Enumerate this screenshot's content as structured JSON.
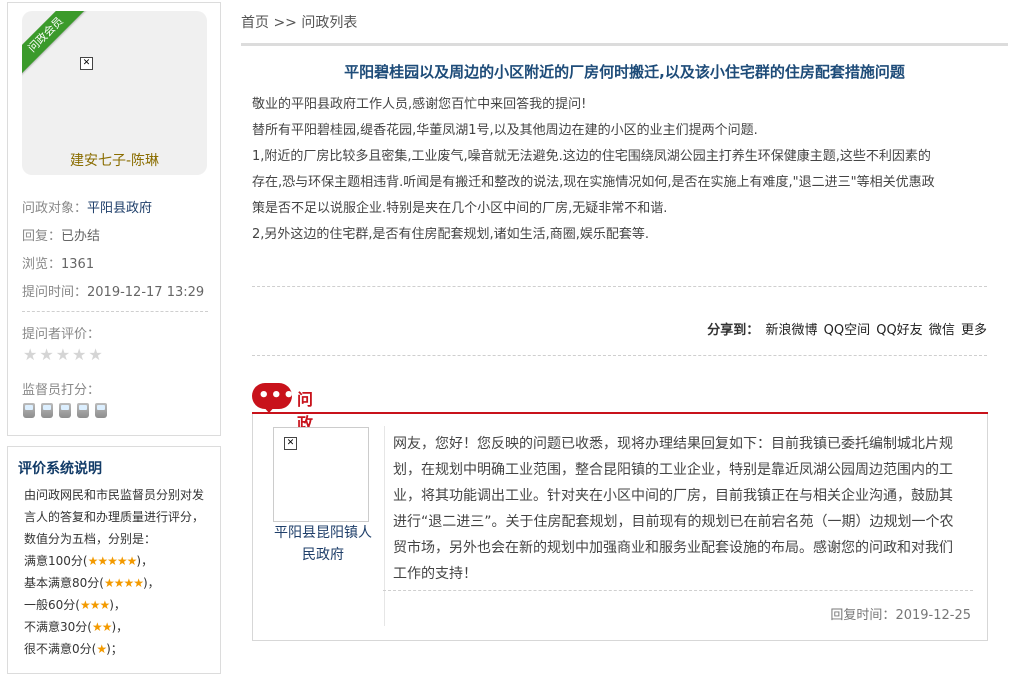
{
  "profile": {
    "badge": "问政会员",
    "name": "建安七子-陈琳",
    "target_label": "问政对象：",
    "target_value": "平阳县政府",
    "reply_label": "回复：",
    "reply_value": "已办结",
    "views_label": "浏览：",
    "views_value": "1361",
    "asktime_label": "提问时间：",
    "asktime_value": "2019-12-17 13:29",
    "asker_rating_label": "提问者评价：",
    "asker_rating_stars": 0,
    "supervisor_label": "监督员打分：",
    "supervisor_score": 0
  },
  "rating_help": {
    "title": "评价系统说明",
    "intro1": "由问政网民和市民监督员分别对发",
    "intro2": "言人的答复和办理质量进行评分，",
    "intro3": "数值分为五档，分别是：",
    "levels": [
      {
        "text": "满意100分(",
        "stars": "★★★★★",
        "end": ")，"
      },
      {
        "text": "基本满意80分(",
        "stars": "★★★★",
        "end": ")，"
      },
      {
        "text": "一般60分(",
        "stars": "★★★",
        "end": ")，"
      },
      {
        "text": "不满意30分(",
        "stars": "★★",
        "end": ")，"
      },
      {
        "text": "很不满意0分(",
        "stars": "★",
        "end": ")；"
      }
    ]
  },
  "breadcrumb": "首页 >> 问政列表",
  "question": {
    "title": "平阳碧桂园以及周边的小区附近的厂房何时搬迁,以及该小住宅群的住房配套措施问题",
    "lines": [
      "敬业的平阳县政府工作人员,感谢您百忙中来回答我的提问!",
      "替所有平阳碧桂园,缇香花园,华董凤湖1号,以及其他周边在建的小区的业主们提两个问题.",
      "1,附近的厂房比较多且密集,工业废气,噪音就无法避免.这边的住宅围绕凤湖公园主打养生环保健康主题,这些不利因素的",
      "存在,恐与环保主题相违背.听闻是有搬迁和整改的说法,现在实施情况如何,是否在实施上有难度,\"退二进三\"等相关优惠政",
      "策是否不足以说服企业.特别是夹在几个小区中间的厂房,无疑非常不和谐.",
      "2,另外这边的住宅群,是否有住房配套规划,诸如生活,商圈,娱乐配套等."
    ]
  },
  "share": {
    "label": "分享到：",
    "links": [
      "新浪微博",
      "QQ空间",
      "QQ好友",
      "微信",
      "更多"
    ]
  },
  "reply": {
    "section_title": "问政回复",
    "replier_line1": "平阳县昆阳镇人",
    "replier_line2": "民政府",
    "lines": [
      "网友，您好！您反映的问题已收悉，现将办理结果回复如下：目前我镇已委托编制城北片规",
      "划，在规划中明确工业范围，整合昆阳镇的工业企业，特别是靠近凤湖公园周边范围内的工",
      "业，将其功能调出工业。针对夹在小区中间的厂房，目前我镇正在与相关企业沟通，鼓励其",
      "进行“退二进三”。关于住房配套规划，目前现有的规划已在前宕名苑（一期）边规划一个农",
      "贸市场，另外也会在新的规划中加强商业和服务业配套设施的布局。感谢您的问政和对我们",
      "工作的支持！"
    ],
    "time_label": "回复时间：",
    "time_value": "2019-12-25"
  }
}
